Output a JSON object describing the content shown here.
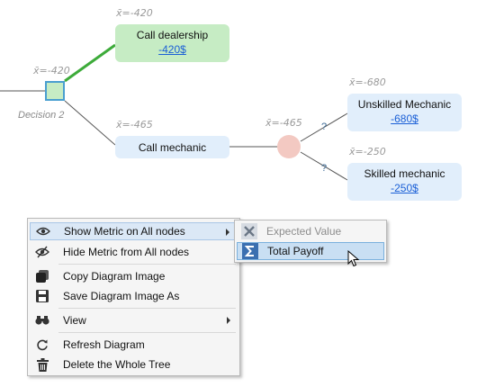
{
  "tree": {
    "decision_node": {
      "label": "Decision 2",
      "metric": "x̄=-420"
    },
    "branches": [
      {
        "name": "Call dealership",
        "value": "-420$",
        "metric": "x̄=-420"
      },
      {
        "name": "Call mechanic",
        "metric": "x̄=-465"
      }
    ],
    "chance_node": {
      "metric": "x̄=-465"
    },
    "outcomes": [
      {
        "name": "Unskilled Mechanic",
        "value": "-680$",
        "metric": "x̄=-680",
        "prob": "?"
      },
      {
        "name": "Skilled mechanic",
        "value": "-250$",
        "metric": "x̄=-250",
        "prob": "?"
      }
    ],
    "colors": {
      "chosen_path": "#3dab3a",
      "edge": "#555555",
      "decision_fill": "#c6ecc4",
      "decision_border": "#4a9fd0",
      "chance_fill": "#f3c9c2",
      "terminal_fill": "#e1eefb",
      "link": "#1a5fd6"
    }
  },
  "context_menu": {
    "items": [
      {
        "label": "Show Metric on All nodes",
        "icon": "eye-icon",
        "submenu": true
      },
      {
        "label": "Hide Metric from All nodes",
        "icon": "eye-slash-icon"
      },
      {
        "label": "Copy Diagram Image",
        "icon": "copy-icon"
      },
      {
        "label": "Save Diagram Image As",
        "icon": "floppy-disk-icon"
      },
      {
        "label": "View",
        "icon": "binoculars-icon",
        "submenu": true
      },
      {
        "label": "Refresh Diagram",
        "icon": "refresh-icon"
      },
      {
        "label": "Delete the Whole Tree",
        "icon": "trash-icon"
      }
    ]
  },
  "sub_menu": {
    "items": [
      {
        "label": "Expected Value",
        "icon": "close-x-icon",
        "disabled": true
      },
      {
        "label": "Total Payoff",
        "icon": "sigma-icon",
        "selected": true
      }
    ]
  }
}
